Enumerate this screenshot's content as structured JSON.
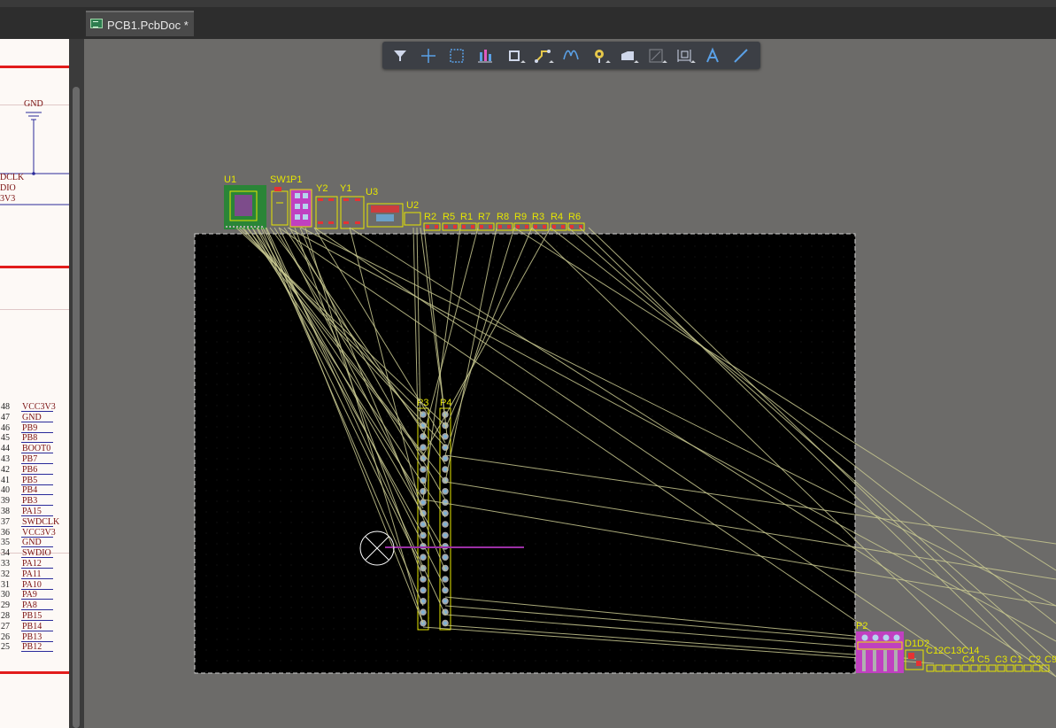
{
  "tabs": [
    {
      "label": "PCB1.PcbDoc *",
      "active": true
    }
  ],
  "toolbar": {
    "tools": [
      {
        "name": "filter-icon",
        "dropdown": false
      },
      {
        "name": "crosshair-icon",
        "dropdown": false
      },
      {
        "name": "select-rect-icon",
        "dropdown": false
      },
      {
        "name": "align-icon",
        "dropdown": false
      },
      {
        "name": "component-icon",
        "dropdown": true
      },
      {
        "name": "route-icon",
        "dropdown": true
      },
      {
        "name": "diff-pair-icon",
        "dropdown": false
      },
      {
        "name": "via-icon",
        "dropdown": true
      },
      {
        "name": "polygon-icon",
        "dropdown": true
      },
      {
        "name": "keepout-icon",
        "dropdown": true
      },
      {
        "name": "dimension-icon",
        "dropdown": true
      },
      {
        "name": "text-icon",
        "dropdown": false
      },
      {
        "name": "line-icon",
        "dropdown": false
      }
    ]
  },
  "schematic": {
    "gnd_label": "GND",
    "left_fragments": [
      "DCLK",
      "DIO",
      "3V3"
    ],
    "pins": [
      {
        "num": "48",
        "name": "VCC3V3"
      },
      {
        "num": "47",
        "name": "GND"
      },
      {
        "num": "46",
        "name": "PB9"
      },
      {
        "num": "45",
        "name": "PB8"
      },
      {
        "num": "44",
        "name": "BOOT0"
      },
      {
        "num": "43",
        "name": "PB7"
      },
      {
        "num": "42",
        "name": "PB6"
      },
      {
        "num": "41",
        "name": "PB5"
      },
      {
        "num": "40",
        "name": "PB4"
      },
      {
        "num": "39",
        "name": "PB3"
      },
      {
        "num": "38",
        "name": "PA15"
      },
      {
        "num": "37",
        "name": "SWDCLK"
      },
      {
        "num": "36",
        "name": "VCC3V3"
      },
      {
        "num": "35",
        "name": "GND"
      },
      {
        "num": "34",
        "name": "SWDIO"
      },
      {
        "num": "33",
        "name": "PA12"
      },
      {
        "num": "32",
        "name": "PA11"
      },
      {
        "num": "31",
        "name": "PA10"
      },
      {
        "num": "30",
        "name": "PA9"
      },
      {
        "num": "29",
        "name": "PA8"
      },
      {
        "num": "28",
        "name": "PB15"
      },
      {
        "num": "27",
        "name": "PB14"
      },
      {
        "num": "26",
        "name": "PB13"
      },
      {
        "num": "25",
        "name": "PB12"
      }
    ]
  },
  "pcb": {
    "designators": {
      "u1": "U1",
      "sw1": "SW1",
      "p1": "P1",
      "y2": "Y2",
      "y1": "Y1",
      "u3": "U3",
      "u2": "U2",
      "resistors": [
        "R2",
        "R5",
        "R1",
        "R7",
        "R8",
        "R9",
        "R3",
        "R4",
        "R6"
      ],
      "p3": "P3",
      "p4": "P4",
      "p2": "P2",
      "d1d2": "D1D2",
      "c_group": "C12C13C14",
      "caps": [
        "C4",
        "C5",
        "C3",
        "C1",
        "C2",
        "C9"
      ]
    },
    "colors": {
      "workspace": "#6c6b69",
      "board": "#000000",
      "silkscreen": "#e6e600",
      "ratsnest": "#c8c890",
      "pad": "#a6a6a6",
      "via_ring": "#7fb2d6",
      "component_body": "#c040c0",
      "origin_marker": "#ffffff",
      "track_purple": "#9b2fa5"
    }
  }
}
